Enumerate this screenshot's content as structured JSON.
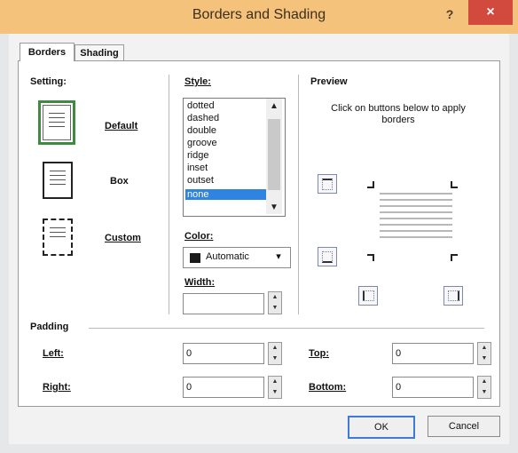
{
  "window": {
    "title": "Borders and Shading",
    "help": "?",
    "close": "×"
  },
  "tabs": [
    "Borders",
    "Shading"
  ],
  "setting": {
    "label": "Setting:",
    "options": [
      "Default",
      "Box",
      "Custom"
    ],
    "selected": "Default"
  },
  "style": {
    "label": "Style:",
    "items": [
      "dotted",
      "dashed",
      "double",
      "groove",
      "ridge",
      "inset",
      "outset",
      "none"
    ],
    "selected": "none"
  },
  "color": {
    "label": "Color:",
    "value": "Automatic",
    "swatch": "#1b1b1b"
  },
  "width": {
    "label": "Width:",
    "value": ""
  },
  "preview": {
    "label": "Preview",
    "hint": "Click on buttons below to apply borders"
  },
  "padding": {
    "label": "Padding",
    "left_label": "Left:",
    "left_value": "0",
    "right_label": "Right:",
    "right_value": "0",
    "top_label": "Top:",
    "top_value": "0",
    "bottom_label": "Bottom:",
    "bottom_value": "0"
  },
  "buttons": {
    "ok": "OK",
    "cancel": "Cancel"
  },
  "colors": {
    "accent": "#2e84e0",
    "titlebar": "#f4c27a",
    "close": "#d24a3e",
    "selected_outline": "#3e8a3e"
  }
}
